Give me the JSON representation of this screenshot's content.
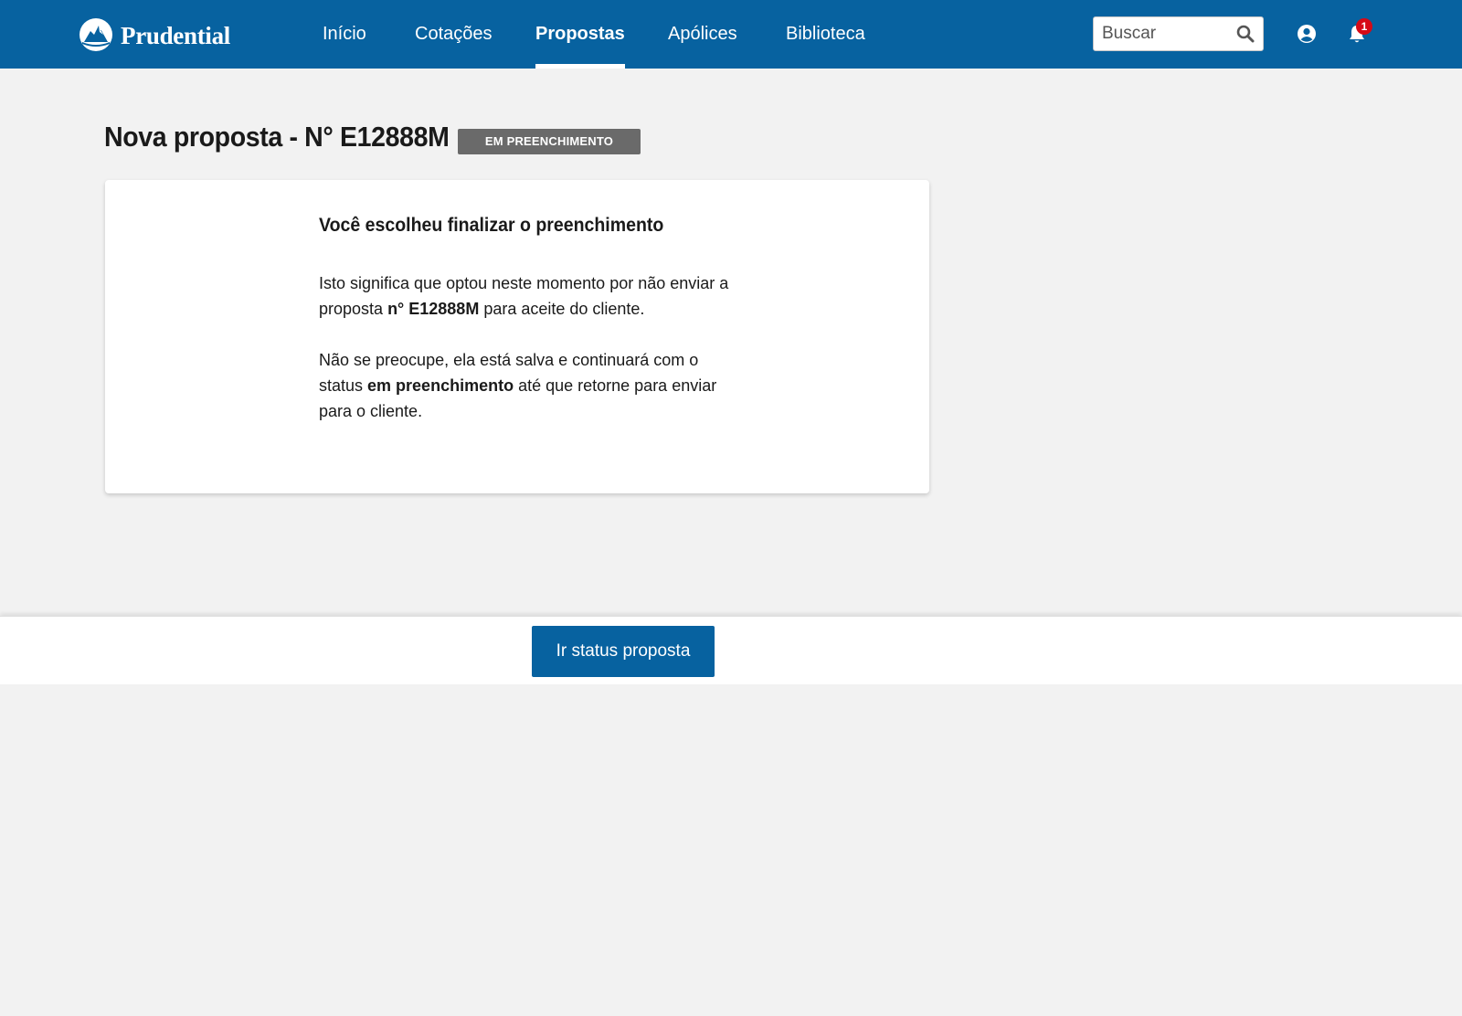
{
  "header": {
    "brand": "Prudential",
    "nav": [
      {
        "label": "Início",
        "active": false
      },
      {
        "label": "Cotações",
        "active": false
      },
      {
        "label": "Propostas",
        "active": true
      },
      {
        "label": "Apólices",
        "active": false
      },
      {
        "label": "Biblioteca",
        "active": false
      }
    ],
    "search": {
      "placeholder": "Buscar",
      "value": ""
    },
    "notifications_count": "1",
    "icons": [
      "prudential-rock-logo-icon",
      "search-icon",
      "user-icon",
      "bell-icon"
    ]
  },
  "page": {
    "title": "Nova proposta - N° E12888M",
    "status_badge": "EM PREENCHIMENTO"
  },
  "card": {
    "heading": "Você escolheu finalizar o preenchimento",
    "p1_before": "Isto significa que optou neste momento por não enviar a proposta ",
    "p1_bold": "n° E12888M",
    "p1_after": " para aceite do cliente.",
    "p2_before": "Não se preocupe, ela está salva e continuará com o status ",
    "p2_bold": "em preenchimento",
    "p2_after": " até que retorne para enviar para o cliente."
  },
  "actions": {
    "primary_label": "Ir status proposta"
  },
  "colors": {
    "brand_blue": "#0762a0",
    "background": "#f2f2f2",
    "badge_gray": "#6a6a6a",
    "notification_red": "#d60a17"
  }
}
